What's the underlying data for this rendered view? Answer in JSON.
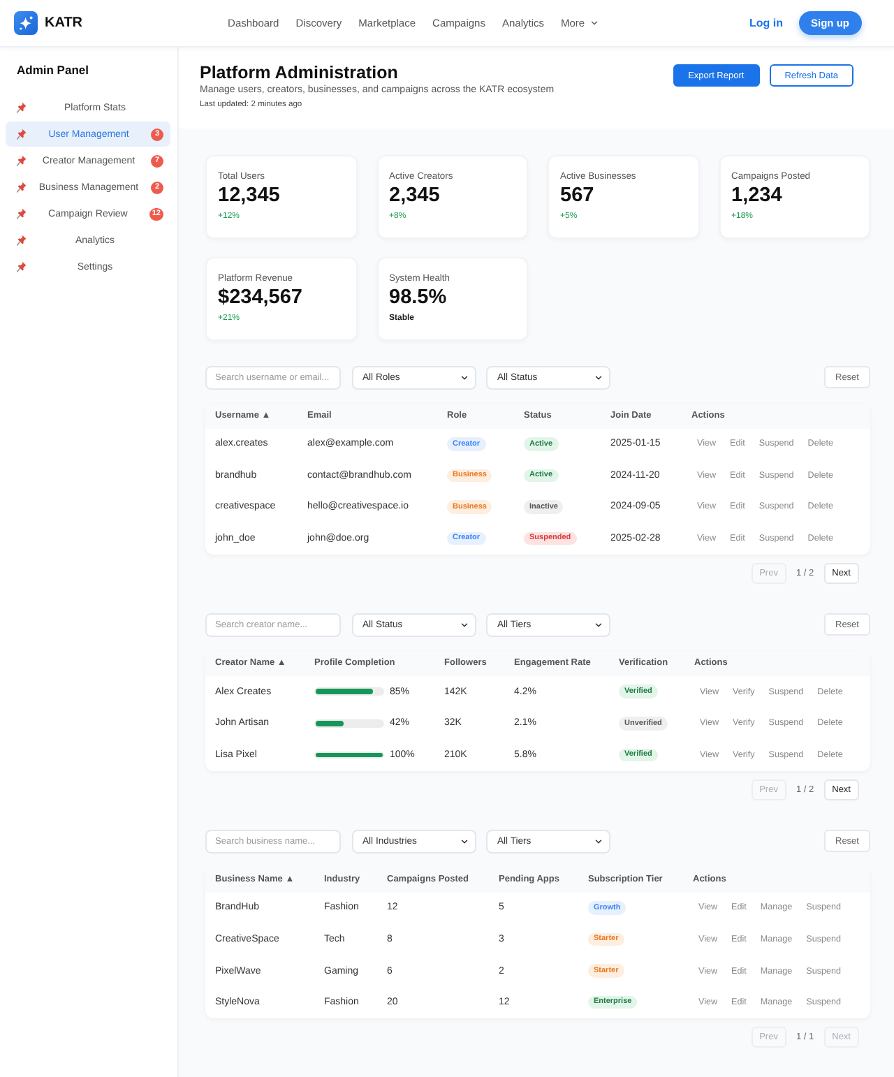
{
  "header": {
    "brand": "KATR",
    "nav": [
      "Dashboard",
      "Discovery",
      "Marketplace",
      "Campaigns",
      "Analytics"
    ],
    "more": "More",
    "login": "Log in",
    "signup": "Sign up"
  },
  "sidebar": {
    "title": "Admin Panel",
    "items": [
      {
        "label": "Platform Stats",
        "selected": false
      },
      {
        "label": "User Management",
        "selected": true,
        "badge": "3"
      },
      {
        "label": "Creator Management",
        "selected": false,
        "badge": "7"
      },
      {
        "label": "Business Management",
        "selected": false,
        "badge": "2"
      },
      {
        "label": "Campaign Review",
        "selected": false,
        "badge": "12"
      },
      {
        "label": "Analytics",
        "selected": false
      },
      {
        "label": "Settings",
        "selected": false
      }
    ]
  },
  "page_header": {
    "title": "Platform Administration",
    "subtitle": "Manage users, creators, businesses, and campaigns across the KATR ecosystem",
    "updated": "Last updated: 2 minutes ago",
    "buttons": [
      {
        "label": "Export Report",
        "kind": "primary"
      },
      {
        "label": "Refresh Data",
        "kind": "outline"
      }
    ]
  },
  "stats": [
    {
      "label": "Total Users",
      "value": "12,345",
      "note": "+12%",
      "kind": "trend"
    },
    {
      "label": "Active Creators",
      "value": "2,345",
      "note": "+8%",
      "kind": "trend"
    },
    {
      "label": "Active Businesses",
      "value": "567",
      "note": "+5%",
      "kind": "trend"
    },
    {
      "label": "Campaigns Posted",
      "value": "1,234",
      "note": "+18%",
      "kind": "trend"
    },
    {
      "label": "Platform Revenue",
      "value": "$234,567",
      "note": "+21%",
      "kind": "trend"
    },
    {
      "label": "System Health",
      "value": "98.5%",
      "note": "Stable",
      "kind": "status"
    }
  ],
  "user_table": {
    "filters": {
      "search_placeholder": "Search username or email...",
      "selects": [
        "All Roles",
        "All Status"
      ],
      "reset": "Reset"
    },
    "columns": [
      "Username ▲",
      "Email",
      "Role",
      "Status",
      "Join Date",
      "Actions"
    ],
    "rows": [
      {
        "username": "alex.creates",
        "email": "alex@example.com",
        "role": {
          "label": "Creator",
          "kind": "creator"
        },
        "status": {
          "label": "Active",
          "kind": "active"
        },
        "join_date": "2025-01-15",
        "actions": [
          "View",
          "Edit",
          "Suspend",
          "Delete"
        ]
      },
      {
        "username": "brandhub",
        "email": "contact@brandhub.com",
        "role": {
          "label": "Business",
          "kind": "business"
        },
        "status": {
          "label": "Active",
          "kind": "active"
        },
        "join_date": "2024-11-20",
        "actions": [
          "View",
          "Edit",
          "Suspend",
          "Delete"
        ]
      },
      {
        "username": "creativespace",
        "email": "hello@creativespace.io",
        "role": {
          "label": "Business",
          "kind": "business"
        },
        "status": {
          "label": "Inactive",
          "kind": "inactive"
        },
        "join_date": "2024-09-05",
        "actions": [
          "View",
          "Edit",
          "Suspend",
          "Delete"
        ]
      },
      {
        "username": "john_doe",
        "email": "john@doe.org",
        "role": {
          "label": "Creator",
          "kind": "creator"
        },
        "status": {
          "label": "Suspended",
          "kind": "suspended"
        },
        "join_date": "2025-02-28",
        "actions": [
          "View",
          "Edit",
          "Suspend",
          "Delete"
        ]
      }
    ],
    "pagination": {
      "prev": {
        "label": "Prev",
        "disabled": true
      },
      "page": "1 / 2",
      "next": {
        "label": "Next",
        "disabled": false
      }
    }
  },
  "creator_table": {
    "filters": {
      "search_placeholder": "Search creator name...",
      "selects": [
        "All Status",
        "All Tiers"
      ],
      "reset": "Reset"
    },
    "columns": [
      "Creator Name ▲",
      "Profile Completion",
      "Followers",
      "Engagement Rate",
      "Verification",
      "Actions"
    ],
    "rows": [
      {
        "name": "Alex Creates",
        "level": 0.85,
        "completion": "85%",
        "followers": "142K",
        "engagement": "4.2%",
        "verification": {
          "label": "Verified",
          "kind": "verified"
        },
        "actions": [
          "View",
          "Verify",
          "Suspend",
          "Delete"
        ]
      },
      {
        "name": "John Artisan",
        "level": 0.42,
        "completion": "42%",
        "followers": "32K",
        "engagement": "2.1%",
        "verification": {
          "label": "Unverified",
          "kind": "unverified"
        },
        "actions": [
          "View",
          "Verify",
          "Suspend",
          "Delete"
        ]
      },
      {
        "name": "Lisa Pixel",
        "level": 1,
        "completion": "100%",
        "followers": "210K",
        "engagement": "5.8%",
        "verification": {
          "label": "Verified",
          "kind": "verified"
        },
        "actions": [
          "View",
          "Verify",
          "Suspend",
          "Delete"
        ]
      }
    ],
    "pagination": {
      "prev": {
        "label": "Prev",
        "disabled": true
      },
      "page": "1 / 2",
      "next": {
        "label": "Next",
        "disabled": false
      }
    }
  },
  "business_table": {
    "filters": {
      "search_placeholder": "Search business name...",
      "selects": [
        "All Industries",
        "All Tiers"
      ],
      "reset": "Reset"
    },
    "columns": [
      "Business Name ▲",
      "Industry",
      "Campaigns Posted",
      "Pending Apps",
      "Subscription Tier",
      "Actions"
    ],
    "rows": [
      {
        "name": "BrandHub",
        "industry": "Fashion",
        "campaigns": "12",
        "pending": "5",
        "tier": {
          "label": "Growth",
          "kind": "growth"
        },
        "actions": [
          "View",
          "Edit",
          "Manage",
          "Suspend"
        ]
      },
      {
        "name": "CreativeSpace",
        "industry": "Tech",
        "campaigns": "8",
        "pending": "3",
        "tier": {
          "label": "Starter",
          "kind": "starter"
        },
        "actions": [
          "View",
          "Edit",
          "Manage",
          "Suspend"
        ]
      },
      {
        "name": "PixelWave",
        "industry": "Gaming",
        "campaigns": "6",
        "pending": "2",
        "tier": {
          "label": "Starter",
          "kind": "starter"
        },
        "actions": [
          "View",
          "Edit",
          "Manage",
          "Suspend"
        ]
      },
      {
        "name": "StyleNova",
        "industry": "Fashion",
        "campaigns": "20",
        "pending": "12",
        "tier": {
          "label": "Enterprise",
          "kind": "enterprise"
        },
        "actions": [
          "View",
          "Edit",
          "Manage",
          "Suspend"
        ]
      }
    ],
    "pagination": {
      "prev": {
        "label": "Prev",
        "disabled": true
      },
      "page": "1 / 1",
      "next": {
        "label": "Next",
        "disabled": true
      }
    }
  }
}
